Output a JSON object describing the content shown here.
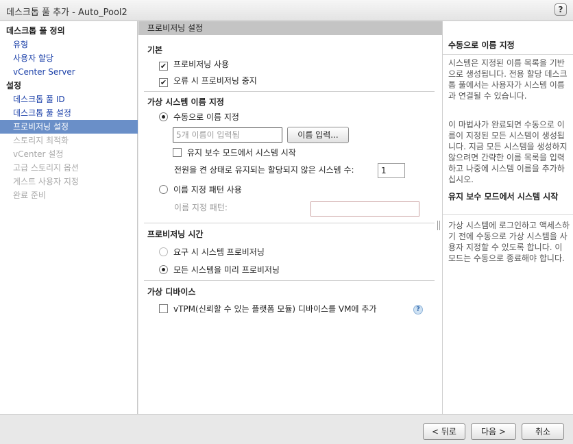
{
  "window": {
    "title": "데스크톱 풀 추가 - Auto_Pool2",
    "help_label": "?"
  },
  "sidebar": {
    "groups": [
      {
        "label": "데스크톱 풀 정의",
        "items": [
          {
            "label": "유형"
          },
          {
            "label": "사용자 할당"
          },
          {
            "label": "vCenter Server"
          }
        ]
      },
      {
        "label": "설정",
        "items": [
          {
            "label": "데스크톱 풀 ID"
          },
          {
            "label": "데스크톱 풀 설정"
          },
          {
            "label": "프로비저닝 설정"
          },
          {
            "label": "스토리지 최적화"
          },
          {
            "label": "vCenter 설정"
          },
          {
            "label": "고급 스토리지 옵션"
          },
          {
            "label": "게스트 사용자 지정"
          },
          {
            "label": "완료 준비"
          }
        ]
      }
    ],
    "active_item": "프로비저닝 설정"
  },
  "main": {
    "header": "프로비저닝 설정",
    "basic": {
      "title": "기본",
      "enable_provisioning": {
        "label": "프로비저닝 사용",
        "checked": true
      },
      "stop_on_error": {
        "label": "오류 시 프로비저닝 중지",
        "checked": true
      }
    },
    "vm_naming": {
      "title": "가상 시스템 이름 지정",
      "manual": {
        "label": "수동으로 이름 지정",
        "selected": true
      },
      "names_input": {
        "value": "5개 이름이 입력됨"
      },
      "enter_names_button": "이름 입력...",
      "maintenance_mode": {
        "label": "유지 보수 모드에서 시스템 시작",
        "checked": false
      },
      "powered_on_label": "전원을 켠 상태로 유지되는 할당되지 않은 시스템 수:",
      "powered_on_value": "1",
      "pattern": {
        "label": "이름 지정 패턴 사용",
        "selected": false
      },
      "pattern_field_label": "이름 지정 패턴:",
      "pattern_value": ""
    },
    "provisioning_timing": {
      "title": "프로비저닝 시간",
      "on_demand": {
        "label": "요구 시 시스템 프로비저닝",
        "selected": false
      },
      "up_front": {
        "label": "모든 시스템을 미리 프로비저닝",
        "selected": true
      }
    },
    "virtual_devices": {
      "title": "가상 디바이스",
      "vtpm": {
        "label": "vTPM(신뢰할 수 있는 플랫폼 모듈) 디바이스를 VM에 추가",
        "checked": false
      },
      "help_label": "?"
    }
  },
  "help_pane": {
    "sections": [
      {
        "title": "수동으로 이름 지정",
        "paragraphs": [
          "시스템은 지정된 이름 목록을 기반으로 생성됩니다. 전용 할당 데스크톱 풀에서는 사용자가 시스템 이름과 연결될 수 있습니다.",
          "이 마법사가 완료되면 수동으로 이름이 지정된 모든 시스템이 생성됩니다. 지금 모든 시스템을 생성하지 않으려면 간략한 이름 목록을 입력하고 나중에 시스템 이름을 추가하십시오."
        ]
      },
      {
        "title": "유지 보수 모드에서 시스템 시작",
        "paragraphs": [
          "가상 시스템에 로그인하고 액세스하기 전에 수동으로 가상 시스템을 사용자 지정할 수 있도록 합니다. 이 모드는 수동으로 종료해야 합니다."
        ]
      }
    ]
  },
  "footer": {
    "back": "< 뒤로",
    "next": "다음 >",
    "cancel": "취소"
  }
}
